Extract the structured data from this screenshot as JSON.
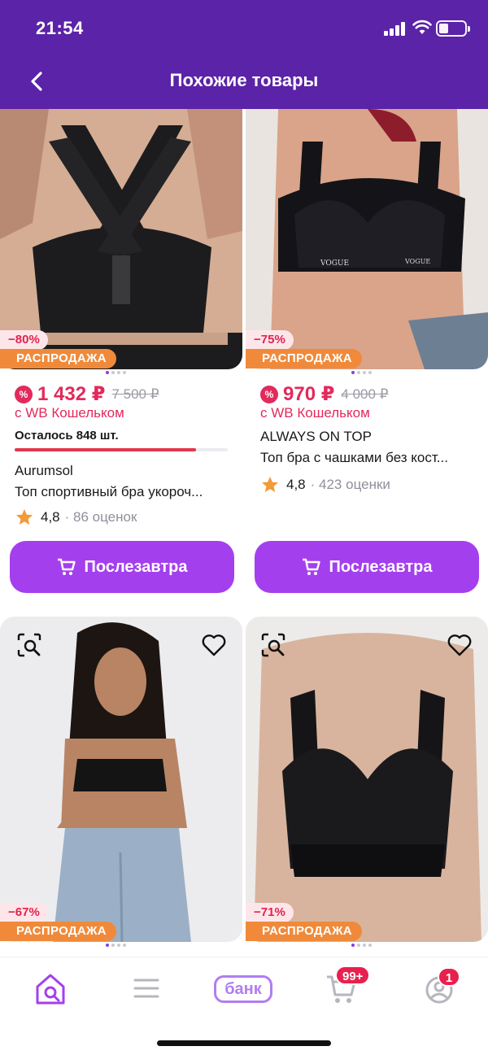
{
  "status_bar": {
    "time": "21:54"
  },
  "header": {
    "title": "Похожие товары",
    "back_icon": "chevron-left-icon"
  },
  "products": [
    {
      "discount": "−80%",
      "sale_label": "РАСПРОДАЖА",
      "price": "1 432 ₽",
      "old_price": "7 500 ₽",
      "wallet": "с WB Кошельком",
      "stock": "Осталось 848 шт.",
      "stock_level": 0.85,
      "brand": "Aurumsol",
      "name": "Топ спортивный бра укороч...",
      "rating": "4,8",
      "reviews": "· 86 оценок",
      "button": "Послезавтра"
    },
    {
      "discount": "−75%",
      "sale_label": "РАСПРОДАЖА",
      "price": "970 ₽",
      "old_price": "4 000 ₽",
      "wallet": "с WB Кошельком",
      "brand": "ALWAYS ON TOP",
      "name": "Топ бра с чашками без кост...",
      "rating": "4,8",
      "reviews": "· 423 оценки",
      "button": "Послезавтра"
    },
    {
      "discount": "−67%",
      "sale_label": "РАСПРОДАЖА"
    },
    {
      "discount": "−71%",
      "sale_label": "РАСПРОДАЖА"
    }
  ],
  "nav": {
    "cart_badge": "99+",
    "profile_badge": "1",
    "bank_label": "банк",
    "items": [
      "home-search-icon",
      "menu-icon",
      "bank-icon",
      "cart-icon",
      "profile-icon"
    ]
  },
  "colors": {
    "header": "#5b23a7",
    "accent": "#a43fee",
    "price": "#e22a5b",
    "sale": "#f08a3a"
  }
}
